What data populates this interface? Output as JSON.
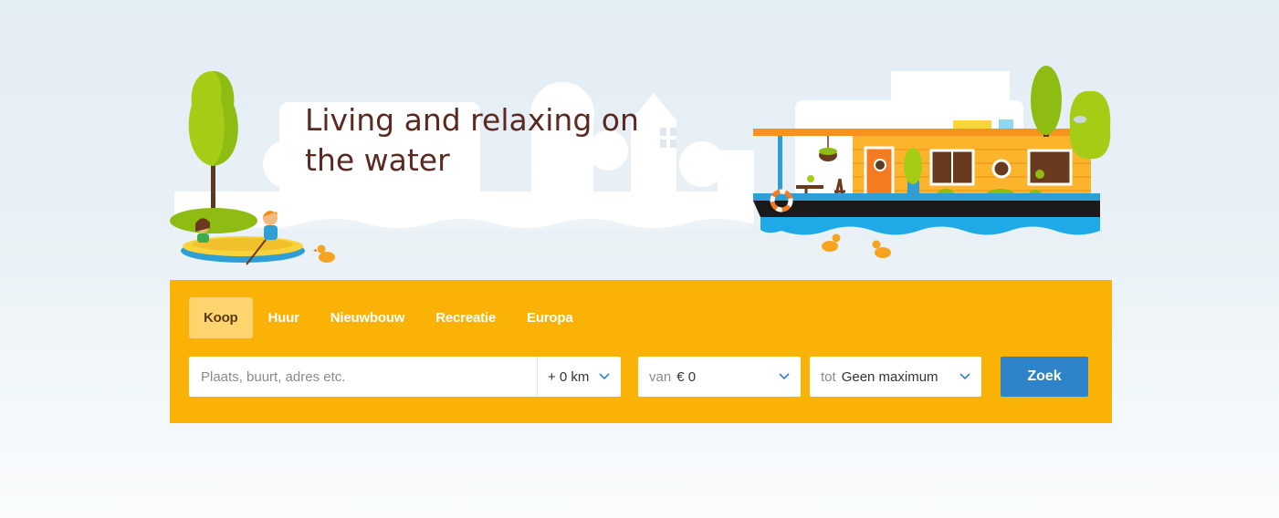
{
  "hero": {
    "headline": "Living and relaxing on the water"
  },
  "search": {
    "tabs": [
      {
        "label": "Koop",
        "active": true
      },
      {
        "label": "Huur",
        "active": false
      },
      {
        "label": "Nieuwbouw",
        "active": false
      },
      {
        "label": "Recreatie",
        "active": false
      },
      {
        "label": "Europa",
        "active": false
      }
    ],
    "location_placeholder": "Plaats, buurt, adres etc.",
    "radius_value": "+ 0 km",
    "price_from_prefix": "van",
    "price_from_value": "€ 0",
    "price_to_prefix": "tot",
    "price_to_value": "Geen maximum",
    "submit_label": "Zoek"
  },
  "colors": {
    "panel": "#fab206",
    "active_tab": "#fdd46e",
    "button": "#2f83c9",
    "headline": "#5a2a20"
  },
  "icons": {
    "dropdown": "chevron-down-icon"
  }
}
